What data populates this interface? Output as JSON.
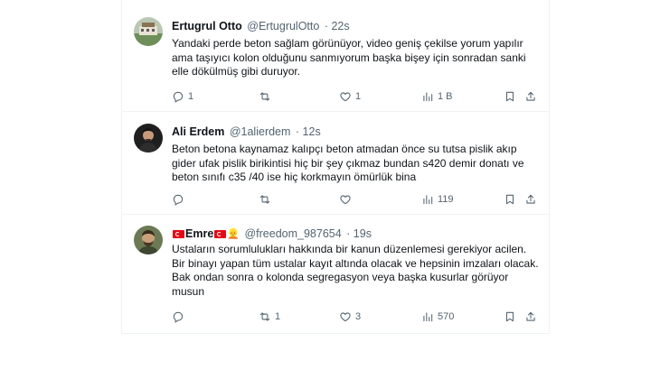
{
  "tweets": [
    {
      "name": "Ertugrul Otto",
      "handle": "@ErtugrulOtto",
      "time": "· 22s",
      "text": "Yandaki perde beton sağlam görünüyor,  video geniş çekilse yorum yapılır ama taşıyıcı kolon olduğunu sanmıyorum başka bişey için sonradan sanki elle dökülmüş gibi duruyor.",
      "replies": "1",
      "retweets": "",
      "likes": "1",
      "views": "1 B"
    },
    {
      "name": "Ali Erdem",
      "handle": "@1alierdem",
      "time": "· 12s",
      "text": "Beton betona kaynamaz kalıpçı beton atmadan önce su tutsa  pislik akıp gider ufak pislik birikintisi hiç bir şey çıkmaz bundan s420 demir donatı ve beton sınıfı c35 /40 ise hiç korkmayın ömürlük bina",
      "replies": "",
      "retweets": "",
      "likes": "",
      "views": "119"
    },
    {
      "name": "Emre",
      "handle": "@freedom_987654",
      "time": "· 19s",
      "text": "Ustaların sorumlulukları hakkında bir kanun düzenlemesi gerekiyor acilen. Bir binayı yapan tüm ustalar kayıt altında olacak ve hepsinin imzaları olacak. Bak ondan sonra o kolonda segregasyon veya başka kusurlar görüyor musun",
      "replies": "",
      "retweets": "1",
      "likes": "3",
      "views": "570"
    }
  ],
  "icons": [
    "reply-icon",
    "retweet-icon",
    "like-icon",
    "views-icon",
    "bookmark-icon",
    "share-icon"
  ],
  "colors": {
    "icon_gray": "#536471",
    "text": "#0f1419",
    "border": "#eff3f4"
  }
}
